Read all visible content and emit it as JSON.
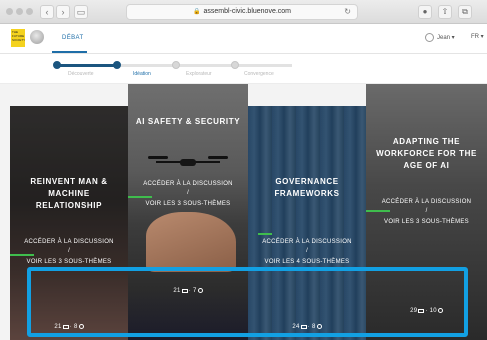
{
  "browser": {
    "url": "assembl-civic.bluenove.com",
    "back_glyph": "‹",
    "forward_glyph": "›",
    "reload_glyph": "↻"
  },
  "header": {
    "logo_text": "THE FUTURE SOCIETY",
    "tab_label": "DÉBAT",
    "user_name": "Jean ▾",
    "language": "FR ▾"
  },
  "phases": [
    {
      "label": "Découverte",
      "state": "done"
    },
    {
      "label": "Idéation",
      "state": "active"
    },
    {
      "label": "Explorateur",
      "state": "upcoming"
    },
    {
      "label": "Convergence",
      "state": "upcoming"
    }
  ],
  "cards": [
    {
      "title": "REINVENT MAN & MACHINE RELATIONSHIP",
      "link_discussion": "ACCÉDER À LA DISCUSSION",
      "separator": "/",
      "link_subthemes": "VOIR LES 3 SOUS-THÈMES",
      "messages": "21",
      "participants": "8"
    },
    {
      "title": "AI SAFETY & SECURITY",
      "link_discussion": "ACCÉDER À LA DISCUSSION",
      "separator": "/",
      "link_subthemes": "VOIR LES 3 SOUS-THÈMES",
      "messages": "21",
      "participants": "7"
    },
    {
      "title": "GOVERNANCE FRAMEWORKS",
      "link_discussion": "ACCÉDER À LA DISCUSSION",
      "separator": "/",
      "link_subthemes": "VOIR LES 4 SOUS-THÈMES",
      "messages": "24",
      "participants": "8"
    },
    {
      "title": "ADAPTING THE WORKFORCE FOR THE AGE OF AI",
      "link_discussion": "ACCÉDER À LA DISCUSSION",
      "separator": "/",
      "link_subthemes": "VOIR LES 3 SOUS-THÈMES",
      "messages": "29",
      "participants": "10"
    }
  ],
  "colors": {
    "brand_blue": "#1e6ea8",
    "phase_done": "#1b557f",
    "accent_green": "#3fbd4d",
    "highlight_box": "#12a0e3"
  }
}
